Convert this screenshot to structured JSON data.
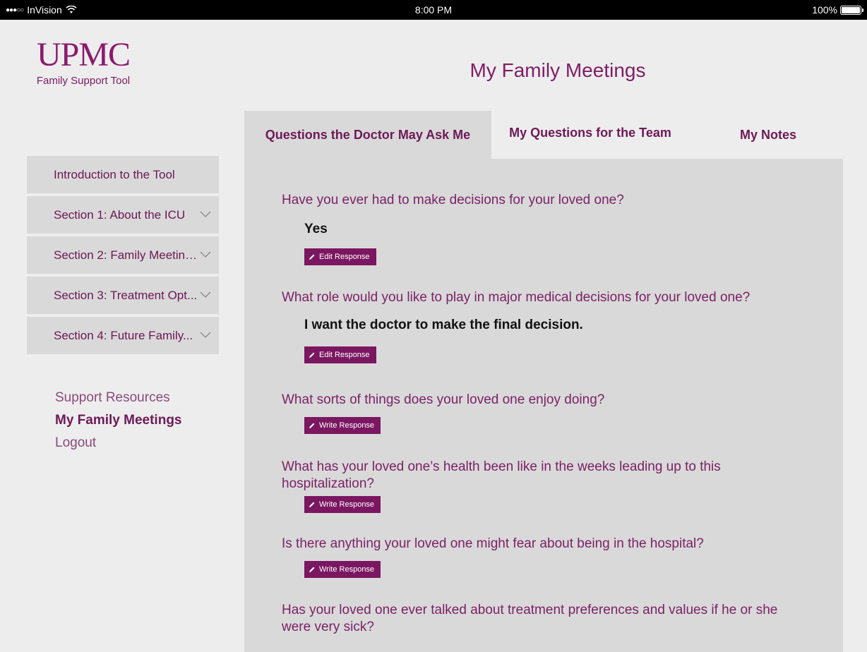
{
  "status": {
    "carrier": "InVision",
    "time": "8:00 PM",
    "battery": "100%"
  },
  "logo": {
    "brand": "UPMC",
    "subtitle": "Family Support Tool"
  },
  "page_title": "My Family Meetings",
  "tabs": [
    {
      "label": "Questions the Doctor May Ask Me",
      "active": true
    },
    {
      "label": "My Questions for the Team",
      "active": false
    },
    {
      "label": "My Notes",
      "active": false
    }
  ],
  "sidebar": {
    "items": [
      {
        "label": "Introduction to the Tool",
        "icon": ""
      },
      {
        "label": "Section 1: About the ICU",
        "icon": "chevron-down-icon"
      },
      {
        "label": "Section 2: Family Meeting...",
        "icon": "chevron-down-icon"
      },
      {
        "label": "Section 3: Treatment Opt...",
        "icon": "chevron-down-icon"
      },
      {
        "label": "Section 4: Future Family...",
        "icon": "chevron-down-icon"
      }
    ],
    "links": {
      "support": "Support Resources",
      "meetings": "My Family Meetings",
      "logout": "Logout"
    }
  },
  "questions": [
    {
      "text": "Have you ever had to make decisions for your loved one?",
      "answer": "Yes",
      "button": "Edit Response"
    },
    {
      "text": "What role would you like to play in major medical decisions for your loved one?",
      "answer": "I want the doctor to make the final decision.",
      "button": "Edit Response"
    },
    {
      "text": "What sorts of things does your loved one enjoy doing?",
      "answer": "",
      "button": "Write Response"
    },
    {
      "text": "What has your loved one’s health been like in the weeks leading up to this hospitalization?",
      "answer": "",
      "button": "Write Response"
    },
    {
      "text": "Is there anything your loved one might fear about being in the hospital?",
      "answer": "",
      "button": "Write Response"
    },
    {
      "text": "Has your loved one ever talked about treatment preferences and values if he or she were very sick?",
      "answer": "",
      "button": ""
    }
  ],
  "colors": {
    "brand": "#7b1761",
    "panel": "#d9d9d9",
    "background": "#ededed"
  }
}
